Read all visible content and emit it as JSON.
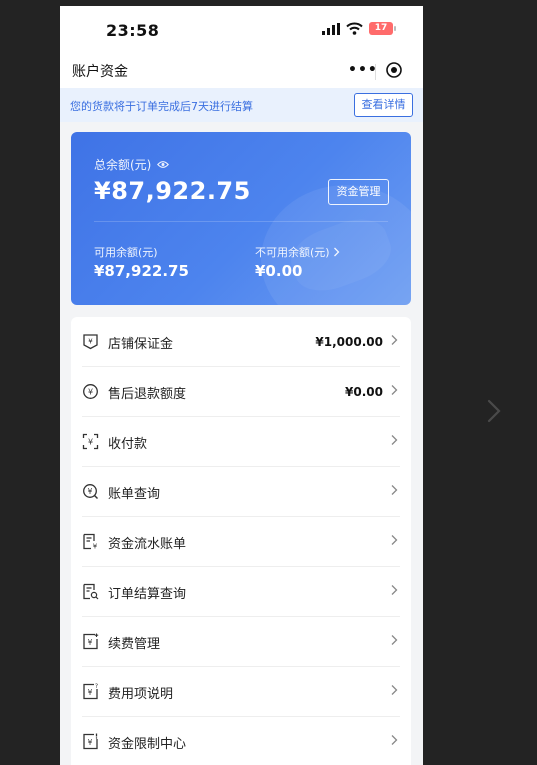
{
  "status_bar": {
    "time": "23:58",
    "battery": "17"
  },
  "nav": {
    "title": "账户资金"
  },
  "notice": {
    "text": "您的货款将于订单完成后7天进行结算",
    "button": "查看详情"
  },
  "balance": {
    "total_label": "总余额(元)",
    "total_amount": "¥87,922.75",
    "manage_button": "资金管理",
    "available_label": "可用余额(元)",
    "available_amount": "¥87,922.75",
    "unavailable_label": "不可用余额(元)",
    "unavailable_amount": "¥0.00"
  },
  "menu": [
    {
      "label": "店铺保证金",
      "value": "¥1,000.00",
      "icon": "shield-yen-icon"
    },
    {
      "label": "售后退款额度",
      "value": "¥0.00",
      "icon": "circle-yen-refresh-icon"
    },
    {
      "label": "收付款",
      "value": "",
      "icon": "scan-yen-icon"
    },
    {
      "label": "账单查询",
      "value": "",
      "icon": "search-yen-icon"
    },
    {
      "label": "资金流水账单",
      "value": "",
      "icon": "document-yen-icon"
    },
    {
      "label": "订单结算查询",
      "value": "",
      "icon": "document-search-icon"
    },
    {
      "label": "续费管理",
      "value": "",
      "icon": "renew-yen-icon"
    },
    {
      "label": "费用项说明",
      "value": "",
      "icon": "fee-info-icon"
    },
    {
      "label": "资金限制中心",
      "value": "",
      "icon": "fund-limit-icon"
    }
  ]
}
